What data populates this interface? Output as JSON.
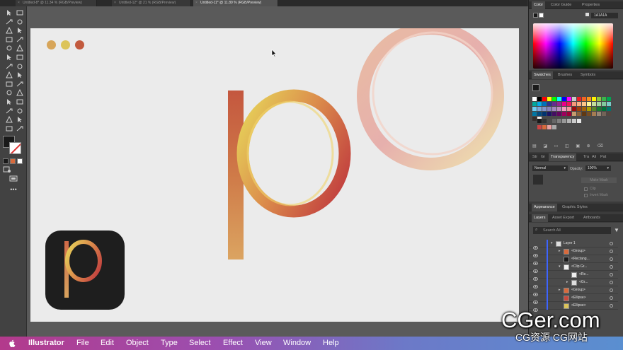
{
  "doc_tabs": [
    {
      "label": "Untitled-8* @ 11.34 % (RGB/Preview)",
      "active": false
    },
    {
      "label": "Untitled-12* @ 21 % (RGB/Preview)",
      "active": false
    },
    {
      "label": "Untitled-11* @ 11.89 % (RGB/Preview)",
      "active": true
    }
  ],
  "colors": {
    "dot1": "#d7a55a",
    "dot2": "#dcc45a",
    "dot3": "#c25a3e",
    "accent_orange": "#d86a3c",
    "selection_blue": "#3d64ff"
  },
  "color_panel": {
    "tabs": [
      "Color",
      "Color Guide",
      "Properties"
    ],
    "hex_value": "1A1A1A"
  },
  "swatches_panel": {
    "tabs": [
      "Swatches",
      "Brushes",
      "Symbols"
    ]
  },
  "transparency_panel": {
    "tabs": [
      "Str",
      "Gr",
      "Transparency",
      "Tra",
      "Ali",
      "Pat"
    ],
    "blend_mode": "Normal",
    "opacity_label": "Opacity:",
    "opacity_value": "100%",
    "make_mask": "Make Mask",
    "clip": "Clip",
    "invert_mask": "Invert Mask"
  },
  "appearance_panel": {
    "tabs": [
      "Appearance",
      "Graphic Styles"
    ]
  },
  "layers_panel": {
    "tabs": [
      "Layers",
      "Asset Export",
      "Artboards"
    ],
    "search_placeholder": "Search All",
    "rows": [
      {
        "name": "Layer 1"
      },
      {
        "name": "<Group>"
      },
      {
        "name": "<Rectang..."
      },
      {
        "name": "<Clip Gr..."
      },
      {
        "name": "<Re..."
      },
      {
        "name": "<Gr..."
      },
      {
        "name": "<Group>"
      },
      {
        "name": "<Ellipse>"
      },
      {
        "name": "<Ellipse>"
      }
    ]
  },
  "menubar": {
    "apple": "",
    "app_name": "Illustrator",
    "items": [
      "File",
      "Edit",
      "Object",
      "Type",
      "Select",
      "Effect",
      "View",
      "Window",
      "Help"
    ]
  },
  "watermark": {
    "main": "CGer.com",
    "sub": "CG资源 CG网站"
  },
  "icons": {
    "apple": "apple-icon",
    "cursor": "arrow-cursor-icon",
    "search": "search-icon",
    "filter": "filter-icon",
    "eye": "eye-icon"
  }
}
